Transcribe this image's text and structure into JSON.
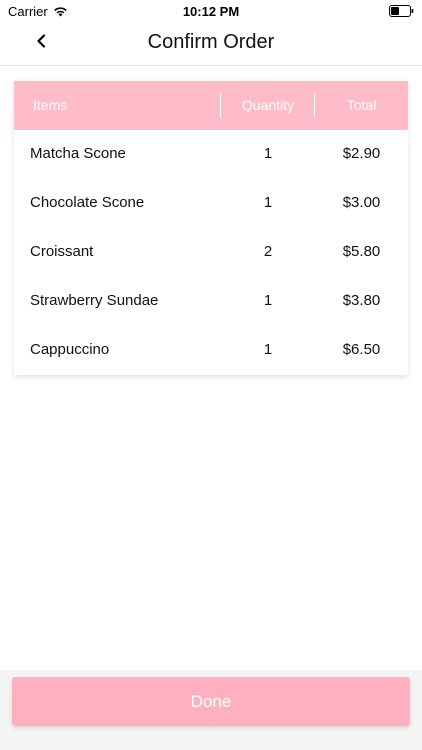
{
  "status_bar": {
    "carrier": "Carrier",
    "time": "10:12 PM"
  },
  "nav": {
    "title": "Confirm Order"
  },
  "table": {
    "headers": {
      "items": "Items",
      "quantity": "Quantity",
      "total": "Total"
    },
    "rows": [
      {
        "name": "Matcha Scone",
        "quantity": "1",
        "total": "$2.90"
      },
      {
        "name": "Chocolate Scone",
        "quantity": "1",
        "total": "$3.00"
      },
      {
        "name": "Croissant",
        "quantity": "2",
        "total": "$5.80"
      },
      {
        "name": "Strawberry Sundae",
        "quantity": "1",
        "total": "$3.80"
      },
      {
        "name": "Cappuccino",
        "quantity": "1",
        "total": "$6.50"
      }
    ]
  },
  "done_button": {
    "label": "Done"
  },
  "colors": {
    "header_pink": "#ffbcc8",
    "button_pink": "#ffb0c0"
  }
}
